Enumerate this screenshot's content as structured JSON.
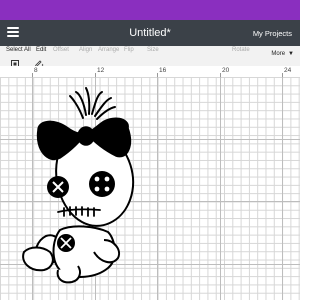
{
  "window": {
    "title": "Untitled*",
    "my_projects": "My Projects"
  },
  "toolbar": {
    "items": [
      {
        "label": "Select All",
        "dim": false
      },
      {
        "label": "Edit",
        "dim": false
      },
      {
        "label": "Offset",
        "dim": true
      },
      {
        "label": "Align",
        "dim": true
      },
      {
        "label": "Arrange",
        "dim": true
      },
      {
        "label": "Flip",
        "dim": true
      },
      {
        "label": "Size",
        "dim": true
      },
      {
        "label": "Rotate",
        "dim": true
      }
    ],
    "more_label": "More"
  },
  "ruler": {
    "ticks": [
      "8",
      "12",
      "16",
      "20",
      "24"
    ]
  },
  "design": {
    "name": "scrump-doll-silhouette",
    "fill": "#000000",
    "stroke": "#000000",
    "background": "#ffffff"
  },
  "colors": {
    "accent": "#8a2fbf",
    "titlebar": "#3b4148"
  }
}
